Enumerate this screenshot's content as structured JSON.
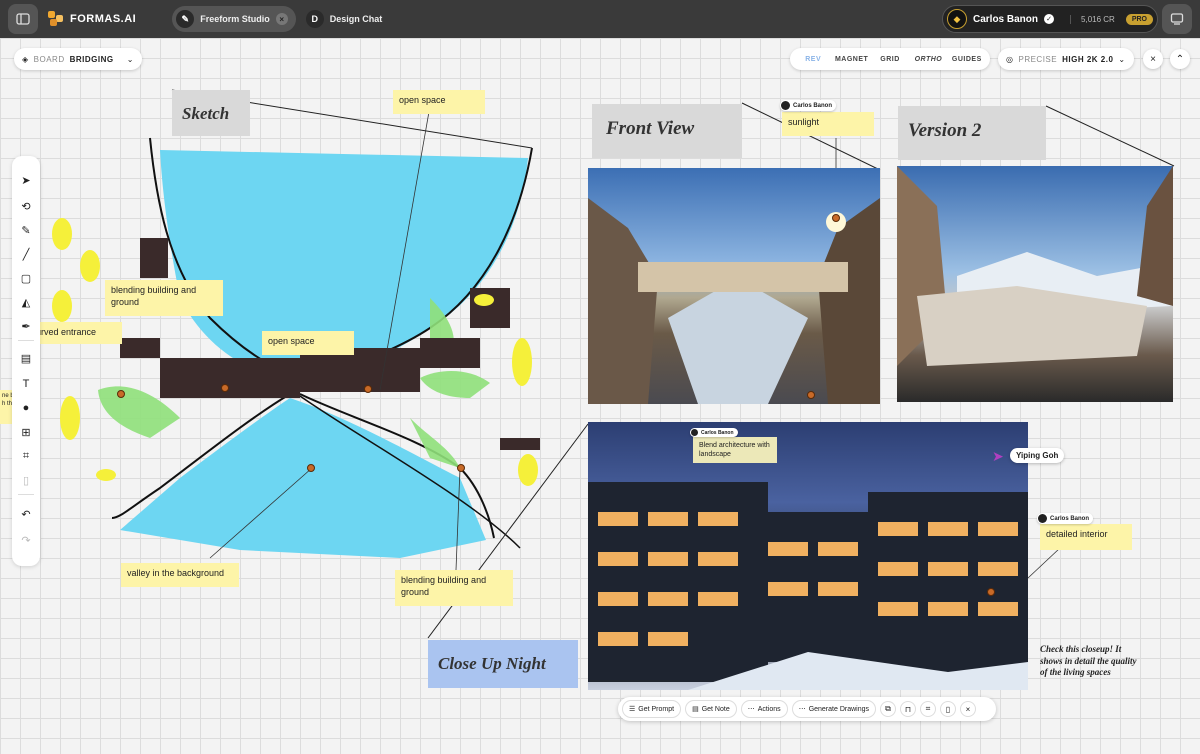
{
  "topbar": {
    "brand": "FORMAS.AI",
    "tabs": [
      {
        "label": "Freeform Studio",
        "active": true,
        "icon": "F"
      },
      {
        "label": "Design Chat",
        "active": false,
        "icon": "D"
      }
    ],
    "user": {
      "name": "Carlos Banon",
      "credits": "5,016 CR",
      "plan": "PRO"
    }
  },
  "board": {
    "label": "BOARD",
    "value": "BRIDGING"
  },
  "modes": [
    "REV",
    "MAGNET",
    "GRID",
    "ORTHO",
    "GUIDES"
  ],
  "render": {
    "label": "PRECISE",
    "value": "HIGH 2K 2.0"
  },
  "labels": {
    "sketch": "Sketch",
    "front_view": "Front View",
    "version2": "Version 2",
    "close_up": "Close Up Night"
  },
  "notes": {
    "open_space_top": "open space",
    "blending1": "blending building  and ground",
    "curved": "urved entrance",
    "open_space_mid": "open space",
    "valley": "valley in the background",
    "blending2": "blending building  and ground",
    "sunlight": "sunlight",
    "blend_arch": "Blend architecture with landscape",
    "detailed": "detailed interior",
    "left_partial": "ne base\nh the"
  },
  "tags": {
    "carlos1": "Carlos Banon",
    "carlos2": "Carlos Banon",
    "carlos3": "Carlos Banon",
    "yiping": "Yiping Goh"
  },
  "handwritten": "Check this closeup! It shows in detail the quality of the living spaces",
  "actions": {
    "get_prompt": "Get Prompt",
    "get_note": "Get Note",
    "actions": "Actions",
    "generate": "Generate Drawings"
  }
}
